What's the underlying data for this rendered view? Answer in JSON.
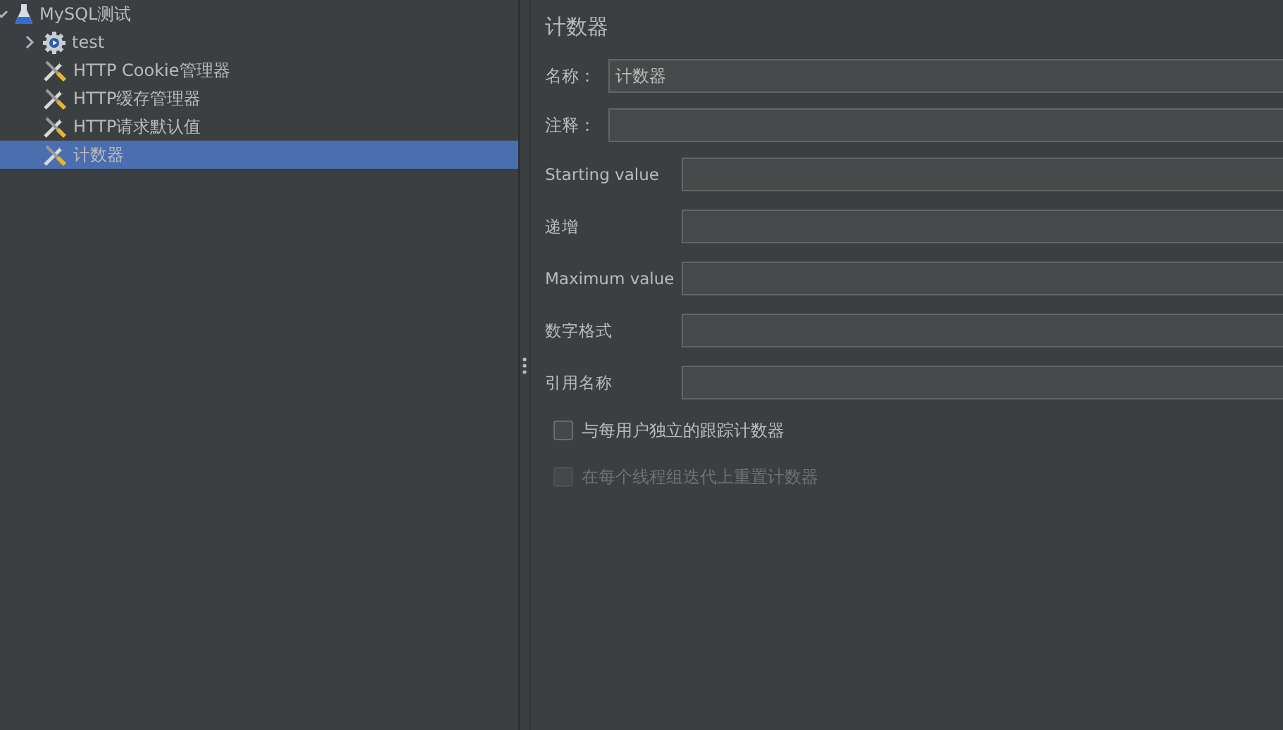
{
  "tree": {
    "label": "MySQL测试",
    "kind": "plan",
    "expanded": true,
    "selected": false,
    "children": [
      {
        "label": "test",
        "kind": "thread-group",
        "expanded": false,
        "selected": false
      },
      {
        "label": "HTTP Cookie管理器",
        "kind": "config",
        "selected": false
      },
      {
        "label": "HTTP缓存管理器",
        "kind": "config",
        "selected": false
      },
      {
        "label": "HTTP请求默认值",
        "kind": "config",
        "selected": false
      },
      {
        "label": "计数器",
        "kind": "config",
        "selected": true
      }
    ]
  },
  "panel": {
    "title": "计数器",
    "header_fields": [
      {
        "label": "名称：",
        "value": "计数器"
      },
      {
        "label": "注释："
      }
    ],
    "fields": [
      {
        "label": "Starting value"
      },
      {
        "label": "递增"
      },
      {
        "label": "Maximum value"
      },
      {
        "label": "数字格式"
      },
      {
        "label": "引用名称"
      }
    ],
    "checkboxes": [
      {
        "label": "与每用户独立的跟踪计数器",
        "checked": false,
        "disabled": false
      },
      {
        "label": "在每个线程组迭代上重置计数器",
        "checked": false,
        "disabled": true
      }
    ]
  }
}
